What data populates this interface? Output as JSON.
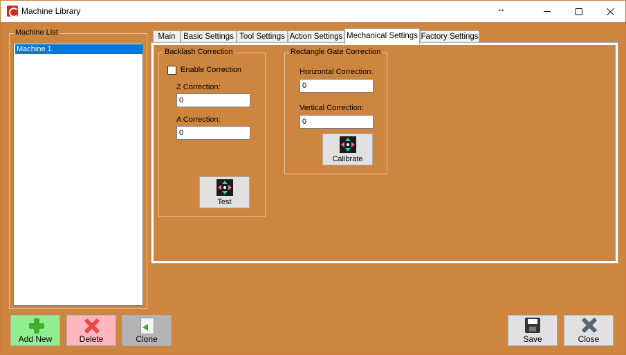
{
  "window": {
    "title": "Machine Library",
    "resize_glyph": "↔"
  },
  "machine_list": {
    "label": "Machine List",
    "items": [
      "Machine 1"
    ]
  },
  "tabs": [
    {
      "label": "Main"
    },
    {
      "label": "Basic Settings"
    },
    {
      "label": "Tool Settings"
    },
    {
      "label": "Action Settings"
    },
    {
      "label": "Mechanical Settings",
      "active": true
    },
    {
      "label": "Factory Settings"
    }
  ],
  "backlash": {
    "group_label": "Backlash Correction",
    "enable_label": "Enable Correction",
    "enable_checked": false,
    "z_label": "Z Correction:",
    "z_value": "0",
    "a_label": "A Correction:",
    "a_value": "0",
    "test_label": "Test",
    "test_icon": "move-arrows-icon"
  },
  "rect_gate": {
    "group_label": "Rectangle Gate Correction",
    "h_label": "Horizontal Correction:",
    "h_value": "0",
    "v_label": "Vertical Correction:",
    "v_value": "0",
    "calibrate_label": "Calibrate",
    "calibrate_icon": "move-arrows-icon"
  },
  "footer": {
    "add_new": "Add New",
    "delete": "Delete",
    "clone": "Clone",
    "save": "Save",
    "close": "Close"
  },
  "colors": {
    "background": "#cd853f",
    "selection": "#0078d7",
    "add_new_bg": "#90ee90",
    "delete_bg": "#ffb6c1",
    "clone_bg": "#b4b4b4",
    "button_bg": "#e1e1e1"
  }
}
